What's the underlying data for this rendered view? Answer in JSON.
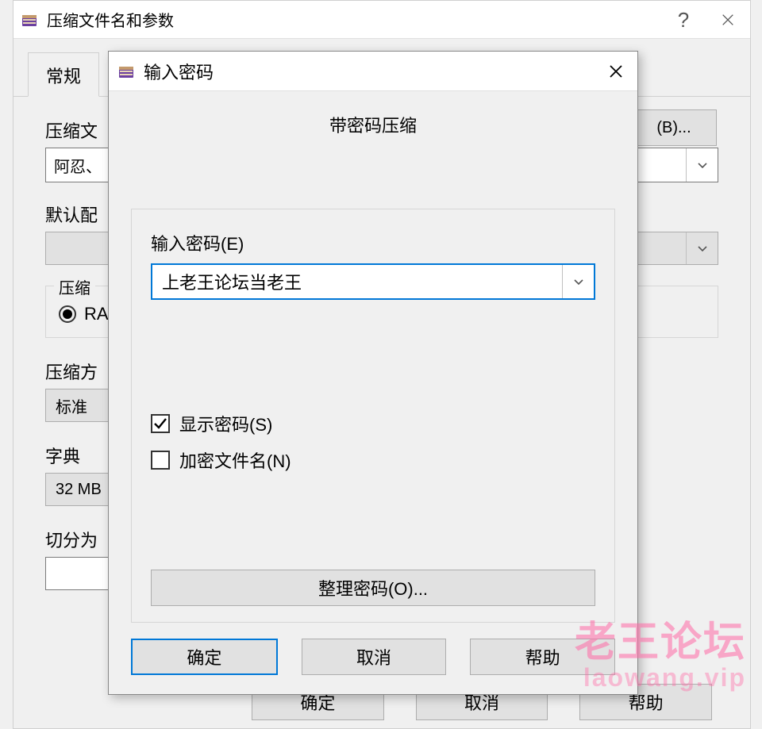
{
  "main": {
    "title": "压缩文件名和参数",
    "help_glyph": "?",
    "tab_general": "常规",
    "filename_label": "压缩文",
    "browse_button": "(B)...",
    "filename_value": "阿忍、",
    "profile_label": "默认配",
    "format_group_label": "压缩",
    "format_rar": "RA",
    "method_label": "压缩方",
    "method_value": "标准",
    "dict_label": "字典",
    "dict_value": "32 MB",
    "split_label": "切分为",
    "ok": "确定",
    "cancel": "取消",
    "help": "帮助"
  },
  "modal": {
    "title": "输入密码",
    "heading": "带密码压缩",
    "password_label": "输入密码(E)",
    "password_value": "上老王论坛当老王",
    "show_password_label": "显示密码(S)",
    "show_password_checked": true,
    "encrypt_names_label": "加密文件名(N)",
    "encrypt_names_checked": false,
    "manage_passwords": "整理密码(O)...",
    "ok": "确定",
    "cancel": "取消",
    "help": "帮助"
  },
  "watermark": {
    "line1": "老王论坛",
    "line2": "laowang.vip"
  }
}
